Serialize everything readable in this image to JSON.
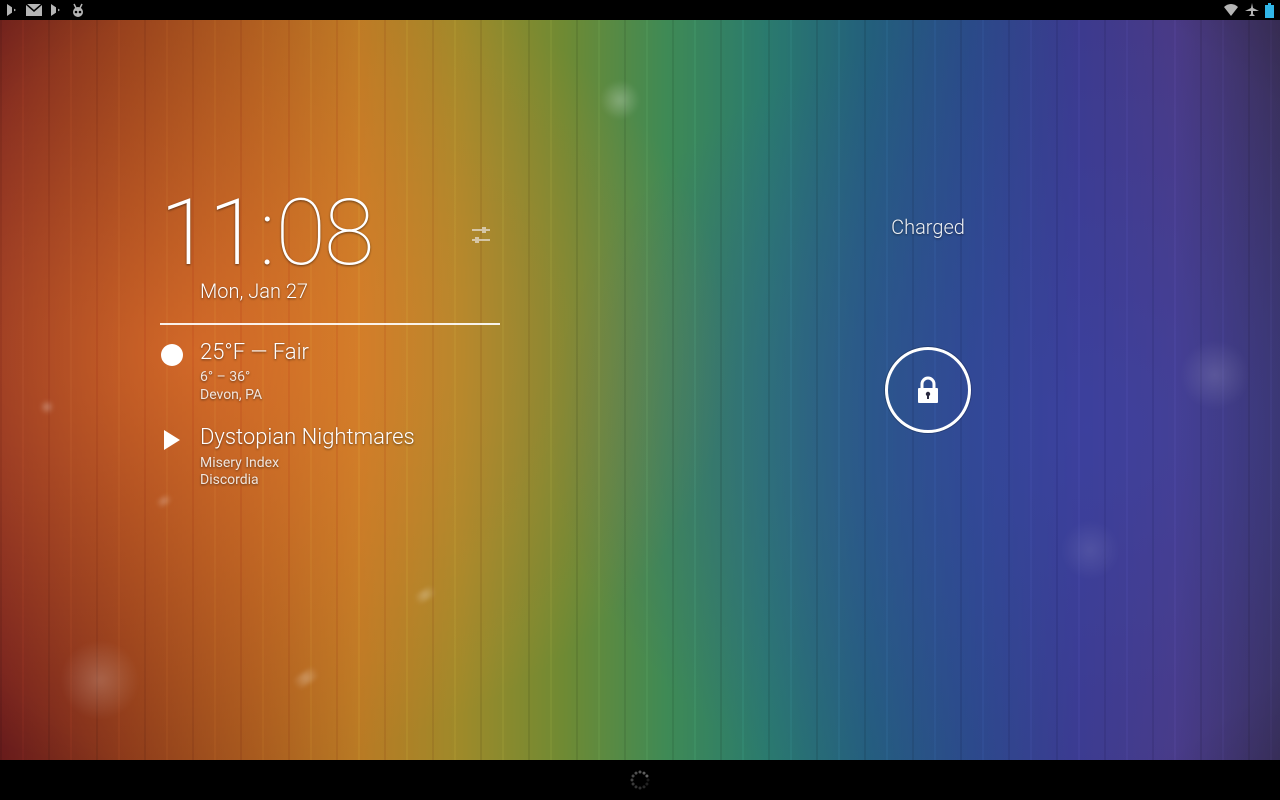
{
  "statusbar": {
    "left_icons": [
      "play-store-icon",
      "gmail-icon",
      "play-store-icon",
      "cyanogenmod-icon"
    ],
    "right_icons": [
      "wifi-icon",
      "airplane-mode-icon",
      "battery-icon"
    ]
  },
  "clock": {
    "hour": "11",
    "minute": "08",
    "date": "Mon, Jan 27"
  },
  "weather": {
    "summary": "25°F — Fair",
    "range": "6° – 36°",
    "location": "Devon, PA"
  },
  "music": {
    "track": "Dystopian Nightmares",
    "artist": "Misery Index",
    "album": "Discordia"
  },
  "battery": {
    "status": "Charged"
  },
  "colors": {
    "battery_full": "#31b6e7",
    "statusbar_icon": "#b5b5b5"
  }
}
